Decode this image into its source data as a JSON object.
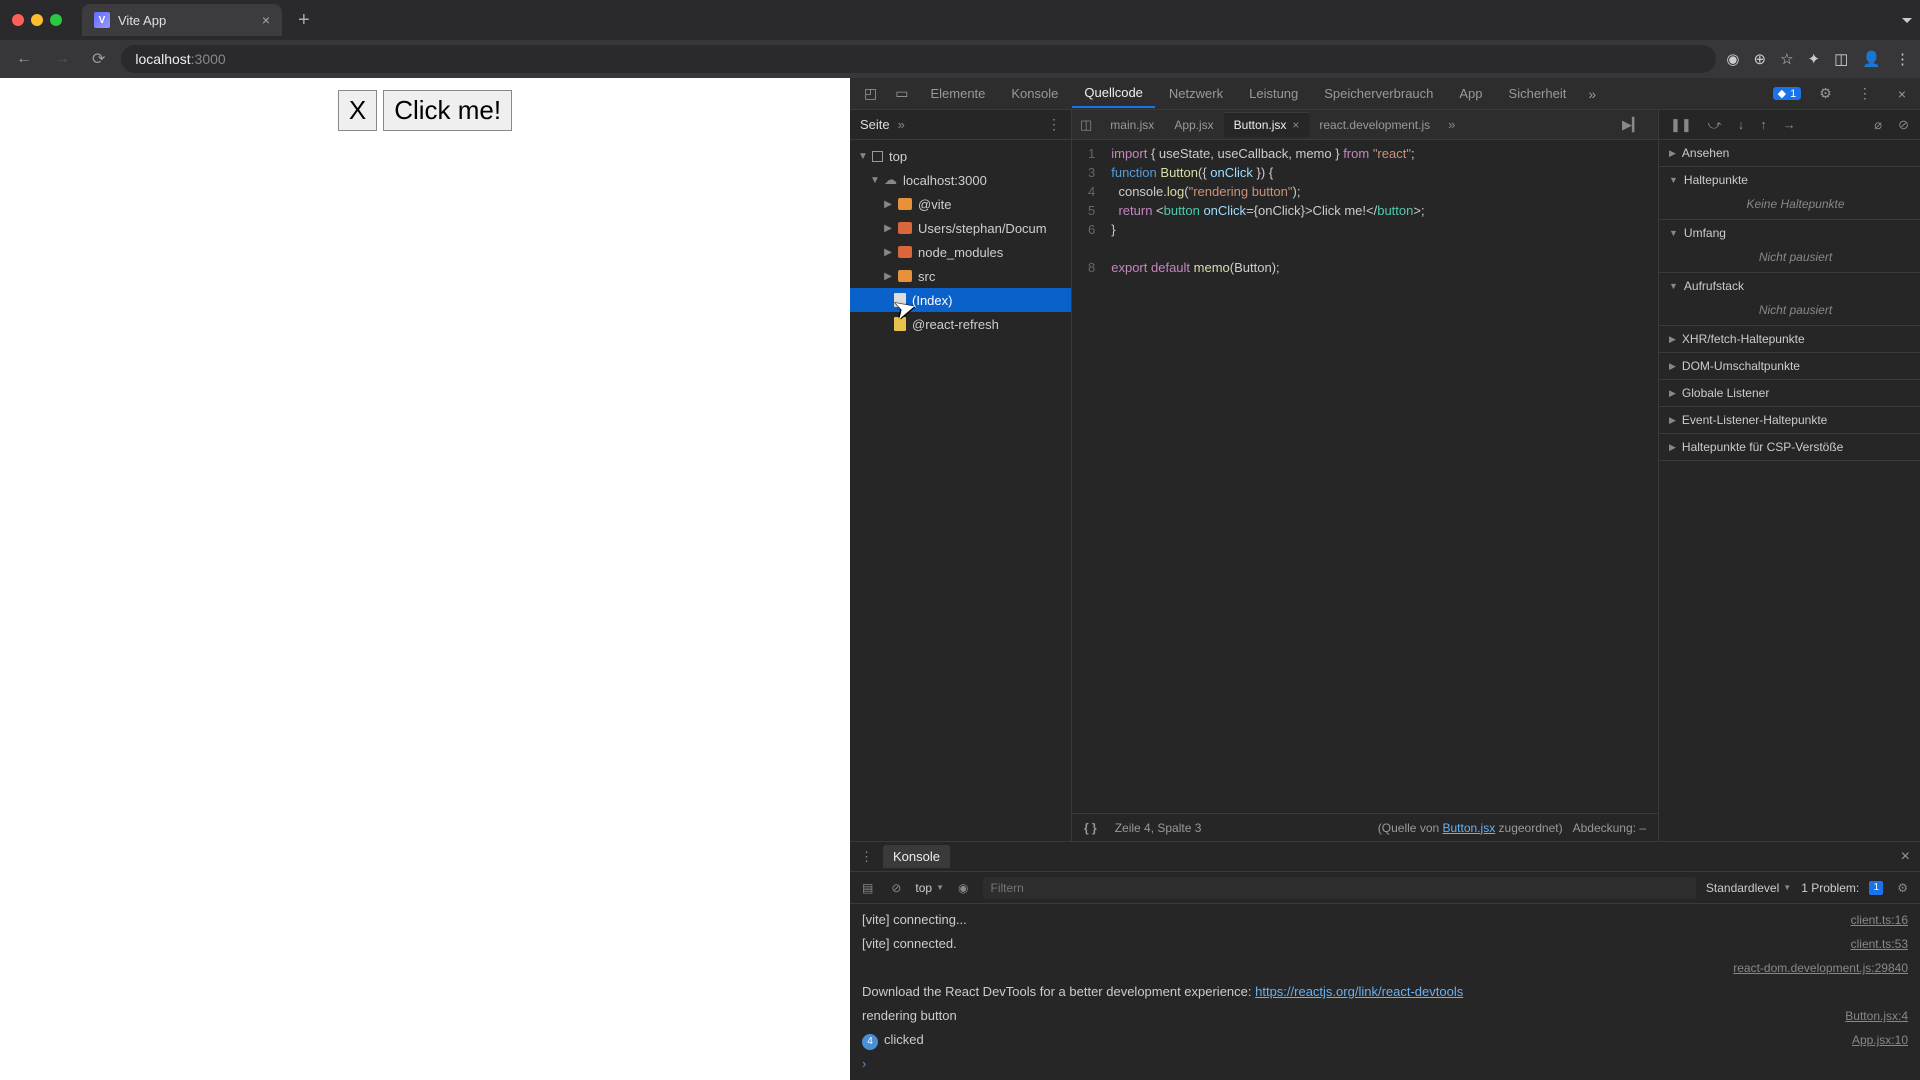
{
  "browser": {
    "tab_title": "Vite App",
    "url_host": "localhost",
    "url_port": ":3000"
  },
  "page": {
    "btn_x": "X",
    "btn_click": "Click me!"
  },
  "devtools": {
    "tabs": [
      "Elemente",
      "Konsole",
      "Quellcode",
      "Netzwerk",
      "Leistung",
      "Speicherverbrauch",
      "App",
      "Sicherheit"
    ],
    "active_tab": "Quellcode",
    "issues_badge": "1",
    "left_panel": {
      "header": "Seite",
      "tree": {
        "top": "top",
        "origin": "localhost:3000",
        "folders": [
          "@vite",
          "Users/stephan/Docum",
          "node_modules",
          "src"
        ],
        "files": [
          "(Index)",
          "@react-refresh"
        ]
      }
    },
    "editor": {
      "tabs": [
        "main.jsx",
        "App.jsx",
        "Button.jsx",
        "react.development.js"
      ],
      "active": "Button.jsx",
      "lines": [
        1,
        3,
        4,
        5,
        6,
        "",
        8
      ],
      "code_tokens": "import { useState, useCallback, memo } from \"react\";\n\nfunction Button({ onClick }) {\n  console.log(\"rendering button\");\n  return <button onClick={onClick}>Click me!</button>;\n}\n\nexport default memo(Button);",
      "status_pos": "Zeile 4, Spalte 3",
      "status_map_prefix": "(Quelle von ",
      "status_map_file": "Button.jsx",
      "status_map_suffix": " zugeordnet)",
      "status_cov": "Abdeckung: –"
    },
    "right_panel": {
      "sections": [
        {
          "title": "Ansehen",
          "body": null
        },
        {
          "title": "Haltepunkte",
          "body": "Keine Haltepunkte"
        },
        {
          "title": "Umfang",
          "body": "Nicht pausiert"
        },
        {
          "title": "Aufrufstack",
          "body": "Nicht pausiert"
        },
        {
          "title": "XHR/fetch-Haltepunkte",
          "body": null
        },
        {
          "title": "DOM-Umschaltpunkte",
          "body": null
        },
        {
          "title": "Globale Listener",
          "body": null
        },
        {
          "title": "Event-Listener-Haltepunkte",
          "body": null
        },
        {
          "title": "Haltepunkte für CSP-Verstöße",
          "body": null
        }
      ]
    },
    "console": {
      "title": "Konsole",
      "context": "top",
      "filter_placeholder": "Filtern",
      "levels": "Standardlevel",
      "problems_label": "1 Problem:",
      "problems_count": "1",
      "logs": [
        {
          "msg": "[vite] connecting...",
          "src": "client.ts:16"
        },
        {
          "msg": "[vite] connected.",
          "src": "client.ts:53"
        },
        {
          "msg": "",
          "src": "react-dom.development.js:29840"
        },
        {
          "msg": "Download the React DevTools for a better development experience: ",
          "link": "https://reactjs.org/link/react-devtools",
          "src": ""
        },
        {
          "msg": "rendering button",
          "src": "Button.jsx:4"
        },
        {
          "count": "4",
          "msg": "clicked",
          "src": "App.jsx:10"
        }
      ]
    }
  }
}
